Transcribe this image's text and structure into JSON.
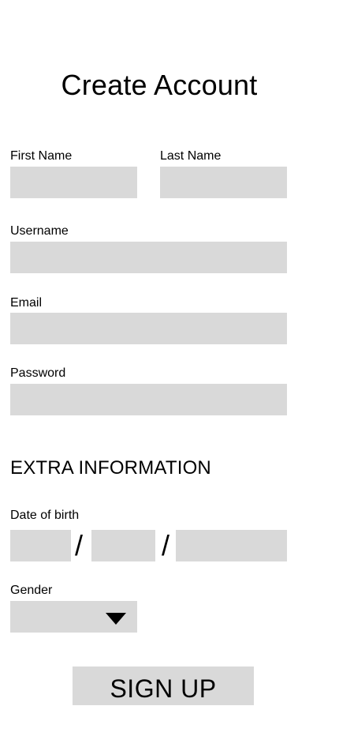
{
  "page": {
    "title": "Create Account"
  },
  "form": {
    "first_name": {
      "label": "First Name",
      "value": ""
    },
    "last_name": {
      "label": "Last Name",
      "value": ""
    },
    "username": {
      "label": "Username",
      "value": ""
    },
    "email": {
      "label": "Email",
      "value": ""
    },
    "password": {
      "label": "Password",
      "value": ""
    }
  },
  "extra": {
    "section_title": "EXTRA INFORMATION",
    "dob": {
      "label": "Date of birth",
      "separator": "/",
      "day": "",
      "month": "",
      "year": ""
    },
    "gender": {
      "label": "Gender",
      "selected": "",
      "icon": "caret-down-icon"
    }
  },
  "actions": {
    "signup_label": "SIGN UP"
  },
  "colors": {
    "field_bg": "#d9d9d9",
    "text": "#000000",
    "background": "#ffffff"
  }
}
